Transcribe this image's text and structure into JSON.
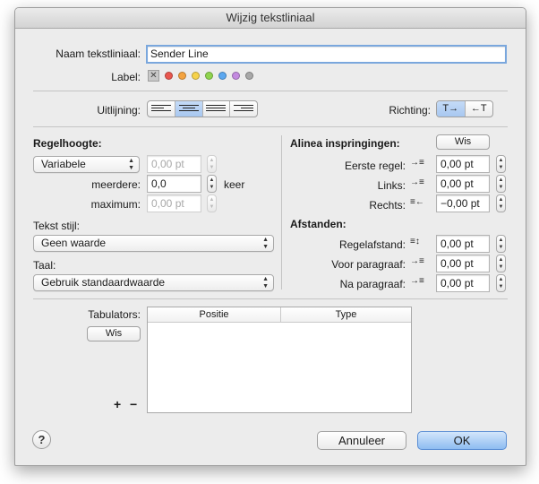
{
  "window": {
    "title": "Wijzig tekstliniaal"
  },
  "name": {
    "label": "Naam tekstliniaal:",
    "value": "Sender Line"
  },
  "label_row": {
    "label": "Label:",
    "colors": [
      "#e9574f",
      "#f4a340",
      "#f6d24a",
      "#8fd44e",
      "#5ca8f0",
      "#c38ae0",
      "#a8a8a8"
    ]
  },
  "alignment": {
    "label": "Uitlijning:",
    "selected": "center"
  },
  "direction": {
    "label": "Richting:",
    "ltr": "T→",
    "rtl": "←T"
  },
  "line_height": {
    "heading": "Regelhoogte:",
    "mode": "Variabele",
    "mode_value": "0,00 pt",
    "multiple_label": "meerdere:",
    "multiple_value": "0,0",
    "multiple_unit": "keer",
    "max_label": "maximum:",
    "max_value": "0,00 pt"
  },
  "text_style": {
    "label": "Tekst stijl:",
    "value": "Geen waarde"
  },
  "language": {
    "label": "Taal:",
    "value": "Gebruik standaardwaarde"
  },
  "indents": {
    "heading": "Alinea inspringingen:",
    "clear": "Wis",
    "first_label": "Eerste regel:",
    "first_value": "0,00 pt",
    "left_label": "Links:",
    "left_value": "0,00 pt",
    "right_label": "Rechts:",
    "right_value": "−0,00 pt"
  },
  "spacing": {
    "heading": "Afstanden:",
    "line_label": "Regelafstand:",
    "line_value": "0,00 pt",
    "before_label": "Voor paragraaf:",
    "before_value": "0,00 pt",
    "after_label": "Na paragraaf:",
    "after_value": "0,00 pt"
  },
  "tabs": {
    "label": "Tabulators:",
    "clear": "Wis",
    "add": "+",
    "remove": "−",
    "col_position": "Positie",
    "col_type": "Type"
  },
  "footer": {
    "help": "?",
    "cancel": "Annuleer",
    "ok": "OK"
  }
}
